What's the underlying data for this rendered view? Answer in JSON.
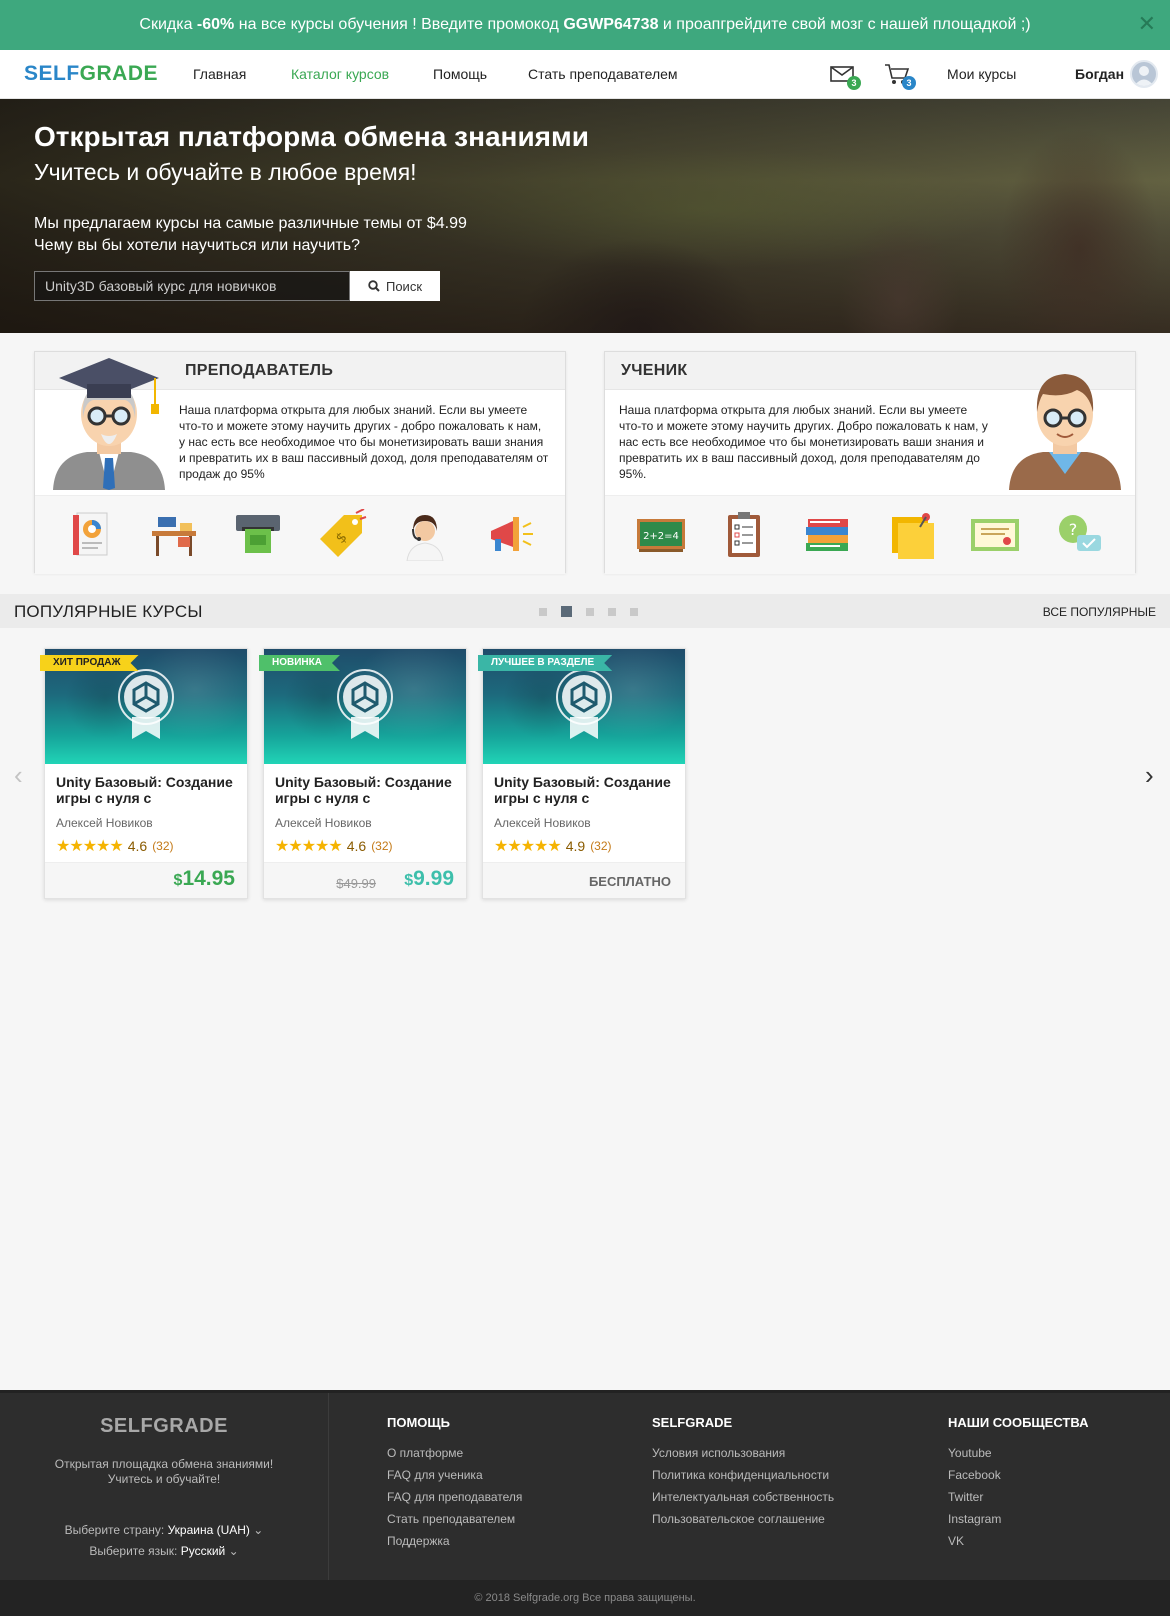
{
  "promo": {
    "text_before": "Скидка ",
    "discount": "-60%",
    "text_middle": " на все курсы обучения ! Введите промокод ",
    "code": "GGWP64738",
    "text_after": " и проапгрейдите свой мозг с нашей площадкой ;)",
    "close": "✕"
  },
  "header": {
    "logo_a": "SELF",
    "logo_b": "GRADE",
    "nav": [
      "Главная",
      "Каталог курсов",
      "Помощь",
      "Стать преподавателем"
    ],
    "mail_count": "3",
    "cart_count": "3",
    "my_courses": "Мои курсы",
    "user": "Богдан",
    "colors": {
      "green": "#3aa853",
      "blue": "#2a86c8"
    }
  },
  "hero": {
    "title": "Открытая платформа обмена знаниями",
    "subtitle": "Учитесь и обучайте в любое время!",
    "line1": "Мы предлагаем курсы на самые различные темы от $4.99",
    "line2": "Чему вы бы хотели научиться или научить?",
    "search_value": "Unity3D базовый курс для новичков",
    "search_button": "Поиск"
  },
  "teacher": {
    "title": "ПРЕПОДАВАТЕЛЬ",
    "text": "Наша платформа открыта для любых знаний. Если вы умеете что-то и можете этому научить других - добро пожаловать к нам, у нас есть все необходимое что бы монетизировать ваши знания и превратить их в ваш пассивный доход, доля преподавателям от продаж до 95%",
    "icons": [
      "report-icon",
      "desk-icon",
      "cash-machine-icon",
      "price-tag-icon",
      "support-operator-icon",
      "megaphone-icon"
    ]
  },
  "student": {
    "title": "УЧЕНИК",
    "text": "Наша платформа открыта для любых знаний. Если вы умеете что-то и можете этому научить других. Добро пожаловать к нам, у нас есть все необходимое что бы монетизировать ваши знания и превратить их в ваш пассивный доход, доля преподавателям до 95%.",
    "icons": [
      "chalkboard-icon",
      "checklist-icon",
      "books-icon",
      "sticky-note-icon",
      "certificate-icon",
      "question-chat-icon"
    ],
    "chalkboard_text": "2+2=4"
  },
  "popular": {
    "title": "ПОПУЛЯРНЫЕ КУРСЫ",
    "all": "ВСЕ ПОПУЛЯРНЫЕ",
    "pages": 5,
    "active_page": 2,
    "prev": "‹",
    "next": "›",
    "courses": [
      {
        "ribbon": "ХИТ ПРОДАЖ",
        "ribbon_bg": "#f7d21a",
        "ribbon_fg": "#222",
        "title": "Unity Базовый: Создание игры с нуля с ипользован...",
        "author": "Алексей Новиков",
        "stars": "★★★★★",
        "rating": "4.6",
        "count": "(32)",
        "currency": "$",
        "price": "14.95",
        "old_price": "",
        "price_color": "#3aa853",
        "free": ""
      },
      {
        "ribbon": "НОВИНКА",
        "ribbon_bg": "#4fc06a",
        "ribbon_fg": "#fff",
        "title": "Unity Базовый: Создание игры с нуля с ипользован...",
        "author": "Алексей Новиков",
        "stars": "★★★★★",
        "rating": "4.6",
        "count": "(32)",
        "currency": "$",
        "price": "9.99",
        "old_price": "$49.99",
        "price_color": "#3dbfab",
        "free": ""
      },
      {
        "ribbon": "ЛУЧШЕЕ В РАЗДЕЛЕ",
        "ribbon_bg": "#3ab6a6",
        "ribbon_fg": "#fff",
        "title": "Unity Базовый: Создание игры с нуля с ипользован...",
        "author": "Алексей Новиков",
        "stars": "★★★★★",
        "rating": "4.9",
        "count": "(32)",
        "currency": "",
        "price": "",
        "old_price": "",
        "price_color": "#666",
        "free": "БЕСПЛАТНО"
      }
    ]
  },
  "footer": {
    "logo": "SELFGRADE",
    "tagline1": "Открытая площадка обмена знаниями!",
    "tagline2": "Учитесь и обучайте!",
    "country_label": "Выберите страну:",
    "country": "Украина (UAH)",
    "lang_label": "Выберите язык:",
    "lang": "Русский",
    "col1": {
      "title": "ПОМОЩЬ",
      "links": [
        "О платформе",
        "FAQ для ученика",
        "FAQ для преподавателя",
        "Стать преподавателем",
        "Поддержка"
      ]
    },
    "col2": {
      "title": "SELFGRADE",
      "links": [
        "Условия использования",
        "Политика конфиденциальности",
        "Интелектуальная собственность",
        "Пользовательское соглашение"
      ]
    },
    "col3": {
      "title": "НАШИ СООБЩЕСТВА",
      "links": [
        "Youtube",
        "Facebook",
        "Twitter",
        "Instagram",
        "VK"
      ]
    },
    "copyright": "© 2018 Selfgrade.org Все права защищены."
  }
}
